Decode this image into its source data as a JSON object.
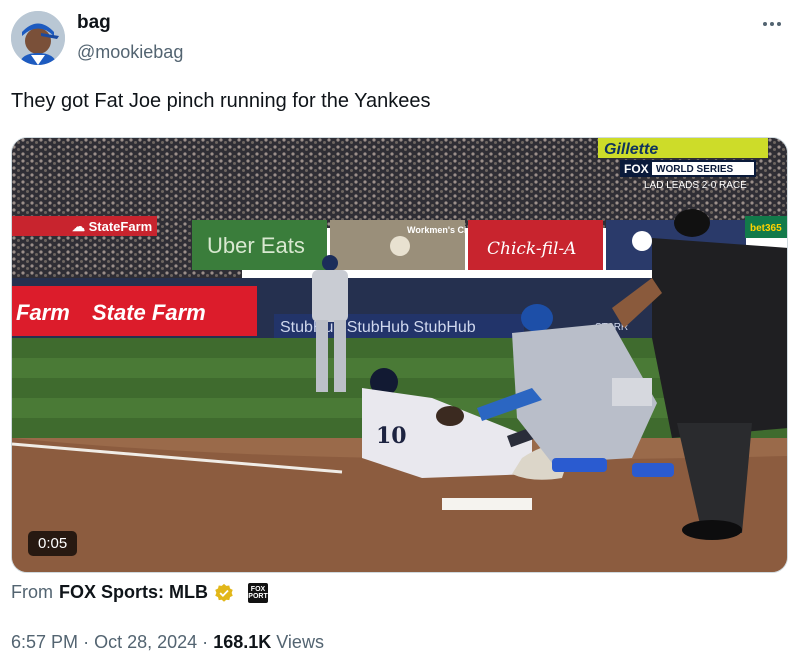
{
  "author": {
    "display_name": "bag",
    "handle": "@mookiebag"
  },
  "tweet": {
    "text": "They got Fat Joe pinch running for the Yankees"
  },
  "media": {
    "duration": "0:05",
    "overlay": {
      "gillette": "Gillette",
      "fox_logo": "FOX",
      "world_series": "WORLD SERIES",
      "series_status": "LAD LEADS 2-0 RACE",
      "state_farm_left": "Farm",
      "state_farm_main": "State Farm",
      "uber_eats": "Uber Eats",
      "workmens_circle": "Workmen's Circle",
      "chick_fil_a": "Chick-fil-A",
      "stubhub": "StubHub StubHub StubHub",
      "bet365": "bet365",
      "starr": "STARR"
    }
  },
  "source": {
    "prefix": "From",
    "name": "FOX Sports: MLB",
    "badge_icon": "verified-gold-check-icon",
    "badge_color": "#e2b719",
    "logo_text": "FOX SPORTS"
  },
  "meta": {
    "time": "6:57 PM",
    "sep1": "·",
    "date": "Oct 28, 2024",
    "sep2": "·",
    "views_count": "168.1K",
    "views_label": "Views"
  }
}
